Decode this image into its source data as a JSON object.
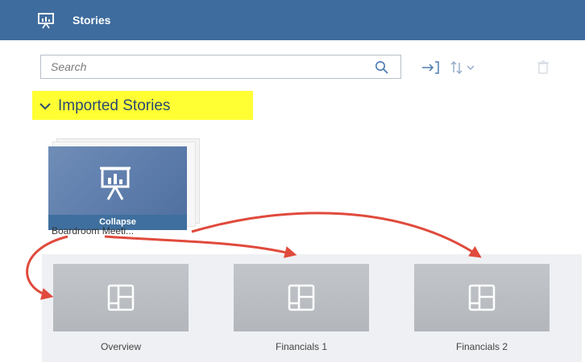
{
  "header": {
    "title": "Stories",
    "color": "#3f6c9e",
    "icon": "presentation-board-icon"
  },
  "search": {
    "placeholder": "Search"
  },
  "toolbar": {
    "icons": [
      "search-icon",
      "move-to-icon",
      "sort-icon",
      "chevron-down-icon",
      "delete-icon"
    ]
  },
  "section": {
    "label": "Imported Stories",
    "highlight_color": "#ffff33",
    "expanded": true
  },
  "story": {
    "name": "Boardroom Meeti...",
    "action": "Collapse",
    "icon": "presentation-board-icon"
  },
  "pages": [
    {
      "label": "Overview"
    },
    {
      "label": "Financials 1"
    },
    {
      "label": "Financials 2"
    }
  ],
  "annotation": {
    "arrow_color": "#e04a3c"
  }
}
